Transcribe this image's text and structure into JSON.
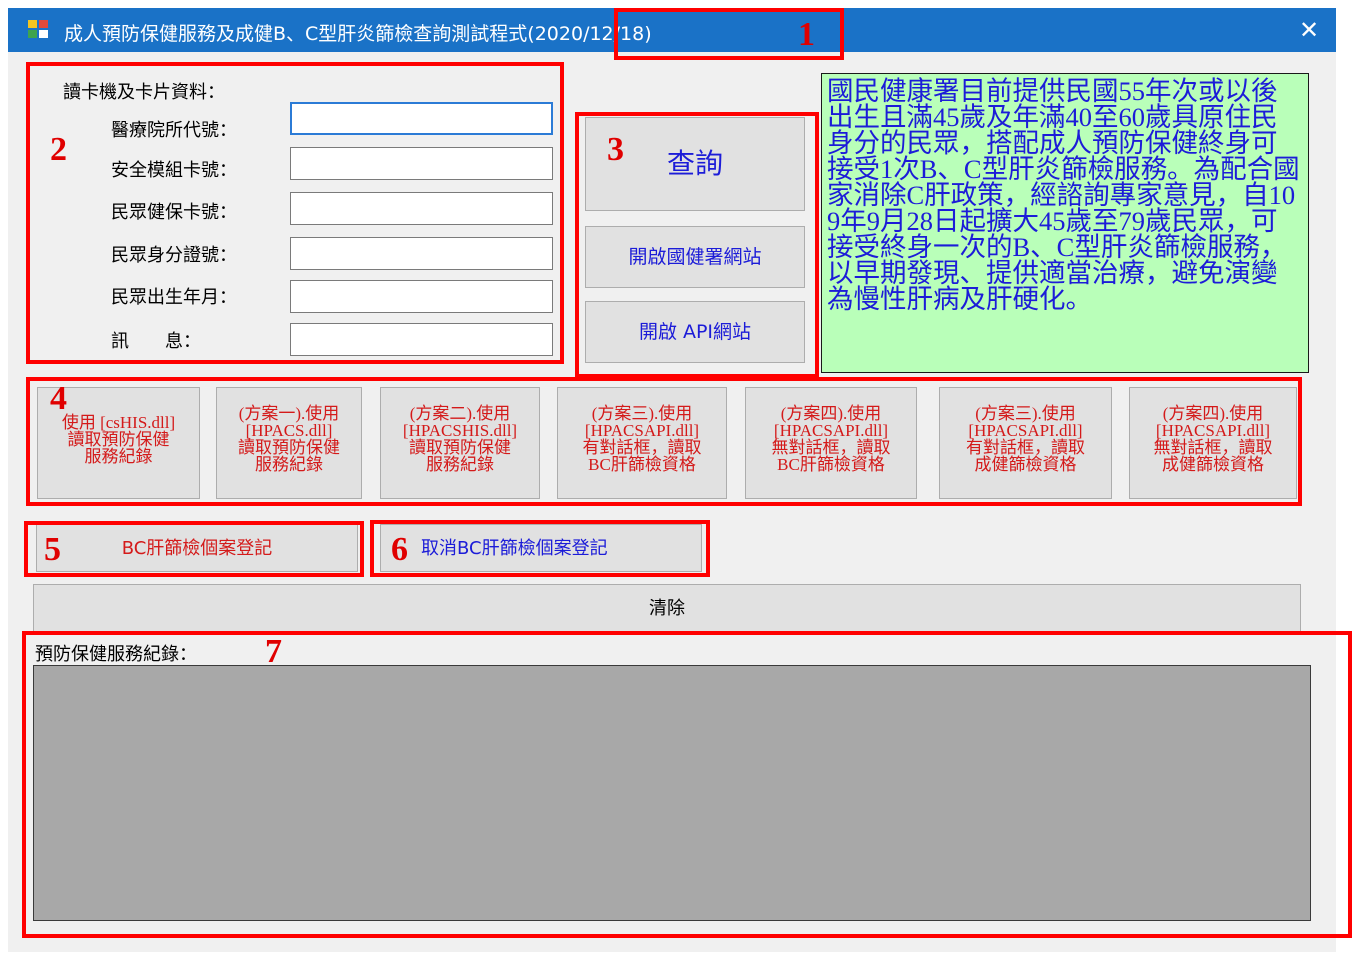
{
  "window": {
    "title": "成人預防保健服務及成健B、C型肝炎篩檢查詢測試程式(2020/12/18)",
    "close_symbol": "✕",
    "colors": {
      "titlebar": "#1a72c7",
      "background": "#f0f0f0",
      "annotation": "#ff0000"
    }
  },
  "card_section": {
    "heading": "讀卡機及卡片資料：",
    "fields": [
      {
        "label": "醫療院所代號：",
        "value": ""
      },
      {
        "label": "安全模組卡號：",
        "value": ""
      },
      {
        "label": "民眾健保卡號：",
        "value": ""
      },
      {
        "label": "民眾身分證號：",
        "value": ""
      },
      {
        "label": "民眾出生年月：",
        "value": ""
      },
      {
        "label": "訊　　息：",
        "value": ""
      }
    ]
  },
  "action_buttons": {
    "query": "查詢",
    "open_hpa_site": "開啟國健署網站",
    "open_api_site": "開啟 API網站"
  },
  "info_text": "國民健康署目前提供民國55年次或以後出生且滿45歲及年滿40至60歲具原住民身分的民眾，搭配成人預防保健終身可接受1次B、C型肝炎篩檢服務。為配合國家消除C肝政策，經諮詢專家意見，自109年9月28日起擴大45歲至79歲民眾，可接受終身一次的B、C型肝炎篩檢服務，以早期發現、提供適當治療，避免演變為慢性肝病及肝硬化。",
  "read_buttons": [
    {
      "lines": [
        "使用 [csHIS.dll]",
        "讀取預防保健",
        "服務紀錄"
      ]
    },
    {
      "lines": [
        "(方案一).使用",
        "[HPACS.dll]",
        "讀取預防保健",
        "服務紀錄"
      ]
    },
    {
      "lines": [
        "(方案二).使用",
        "[HPACSHIS.dll]",
        "讀取預防保健",
        "服務紀錄"
      ]
    },
    {
      "lines": [
        "(方案三).使用",
        "[HPACSAPI.dll]",
        "有對話框，讀取",
        "BC肝篩檢資格"
      ]
    },
    {
      "lines": [
        "(方案四).使用",
        "[HPACSAPI.dll]",
        "無對話框，讀取",
        "BC肝篩檢資格"
      ]
    },
    {
      "lines": [
        "(方案三).使用",
        "[HPACSAPI.dll]",
        "有對話框，讀取",
        "成健篩檢資格"
      ]
    },
    {
      "lines": [
        "(方案四).使用",
        "[HPACSAPI.dll]",
        "無對話框，讀取",
        "成健篩檢資格"
      ]
    }
  ],
  "register_button": "BC肝篩檢個案登記",
  "cancel_register_button": "取消BC肝篩檢個案登記",
  "clear_button": "清除",
  "log_label": "預防保健服務紀錄：",
  "annotations": [
    "1",
    "2",
    "3",
    "4",
    "5",
    "6",
    "7"
  ]
}
